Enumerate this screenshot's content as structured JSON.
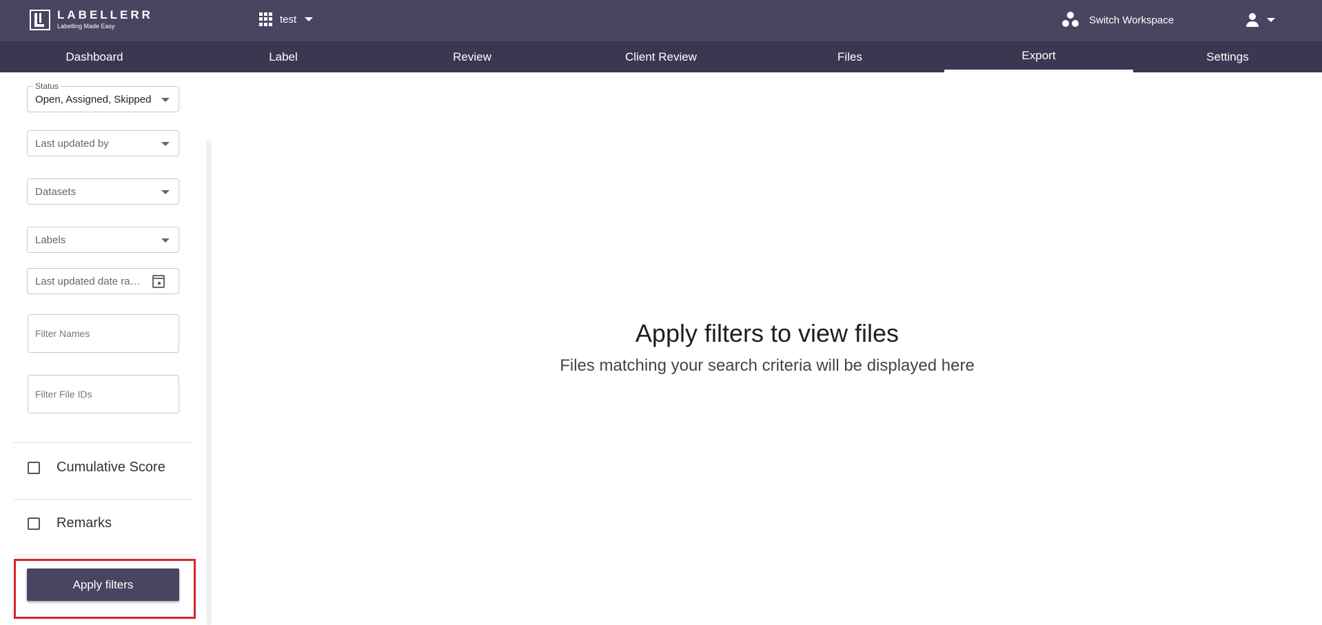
{
  "brand": {
    "name": "LABELLERR",
    "tagline": "Labelling Made Easy"
  },
  "project": {
    "name": "test"
  },
  "header": {
    "switch_workspace": "Switch Workspace"
  },
  "nav": {
    "items": [
      {
        "label": "Dashboard"
      },
      {
        "label": "Label"
      },
      {
        "label": "Review"
      },
      {
        "label": "Client Review"
      },
      {
        "label": "Files"
      },
      {
        "label": "Export",
        "active": true
      },
      {
        "label": "Settings"
      }
    ]
  },
  "filters": {
    "status": {
      "label": "Status",
      "value": "Open, Assigned, Skipped"
    },
    "last_updated_by": {
      "placeholder": "Last updated by"
    },
    "datasets": {
      "placeholder": "Datasets"
    },
    "labels": {
      "placeholder": "Labels"
    },
    "date_range": {
      "placeholder": "Last updated date range"
    },
    "filter_names": {
      "placeholder": "Filter Names"
    },
    "filter_file_ids": {
      "placeholder": "Filter File IDs"
    },
    "cumulative_score": {
      "label": "Cumulative Score",
      "checked": false
    },
    "remarks": {
      "label": "Remarks",
      "checked": false
    },
    "apply_label": "Apply filters"
  },
  "empty_state": {
    "title": "Apply filters to view files",
    "subtitle": "Files matching your search criteria will be displayed here"
  },
  "colors": {
    "topbar": "#474560",
    "navbar": "#3a3850",
    "apply_button": "#474560",
    "highlight": "#d7262b"
  }
}
